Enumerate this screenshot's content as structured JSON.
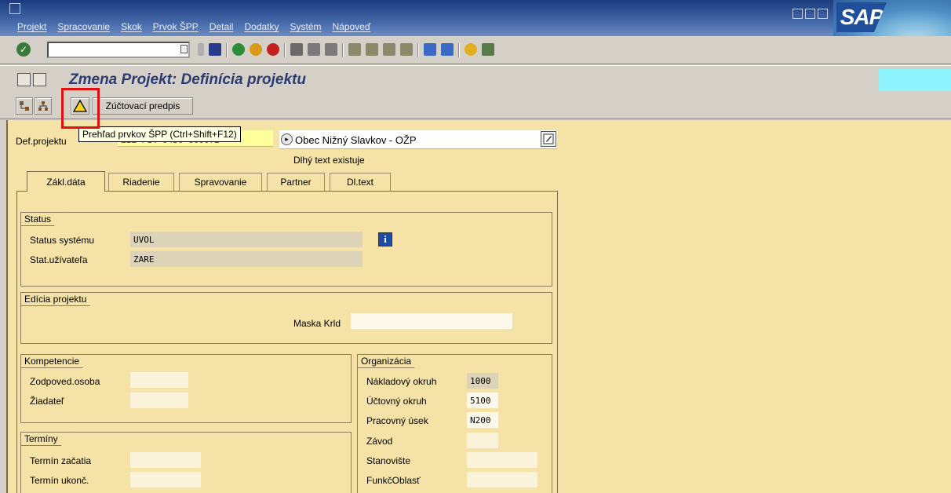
{
  "menu": {
    "items": [
      "Projekt",
      "Spracovanie",
      "Skok",
      "Prvok ŠPP",
      "Detail",
      "Dodatky",
      "Systém",
      "Nápoveď"
    ]
  },
  "brand": {
    "logo_text": "SAP"
  },
  "toolbar": {
    "command_value": ""
  },
  "title": {
    "text": "Zmena Projekt: Definícia projektu"
  },
  "app_toolbar": {
    "accounting_label": "Zúčtovací predpis",
    "tooltip": "Prehľad prvkov ŠPP  (Ctrl+Shift+F12)"
  },
  "header": {
    "def_label": "Def.projektu",
    "def_value_partial": "ZEL-P14-0430-000072",
    "description": "Obec Nižný Slavkov - OŽP",
    "long_text": "Dlhý text existuje"
  },
  "tabs": [
    {
      "label": "Zákl.dáta",
      "active": true
    },
    {
      "label": "Riadenie",
      "active": false
    },
    {
      "label": "Spravovanie",
      "active": false
    },
    {
      "label": "Partner",
      "active": false
    },
    {
      "label": "Dl.text",
      "active": false
    }
  ],
  "status": {
    "title": "Status",
    "system_label": "Status systému",
    "system_value": "UVOL",
    "user_label": "Stat.užívateľa",
    "user_value": "ZARE"
  },
  "edition": {
    "title": "Edícia projektu",
    "mask_label": "Maska Krld",
    "mask_value": ""
  },
  "competence": {
    "title": "Kompetencie",
    "responsible_label": "Zodpoved.osoba",
    "requester_label": "Žiadateľ"
  },
  "dates": {
    "title": "Termíny",
    "start_label": "Termín začatia",
    "end_label": "Termín ukonč."
  },
  "organization": {
    "title": "Organizácia",
    "cost_area_label": "Nákladový okruh",
    "cost_area_value": "1000",
    "company_label": "Účtovný okruh",
    "company_value": "5100",
    "business_area_label": "Pracovný úsek",
    "business_area_value": "N200",
    "plant_label": "Závod",
    "location_label": "Stanovište",
    "functional_area_label": "FunkčOblasť"
  },
  "colors": {
    "menu_bar": "#2a4c8f",
    "form_bg": "#f4e2a7",
    "highlight": "#e01010",
    "title_text": "#2b3a73"
  }
}
